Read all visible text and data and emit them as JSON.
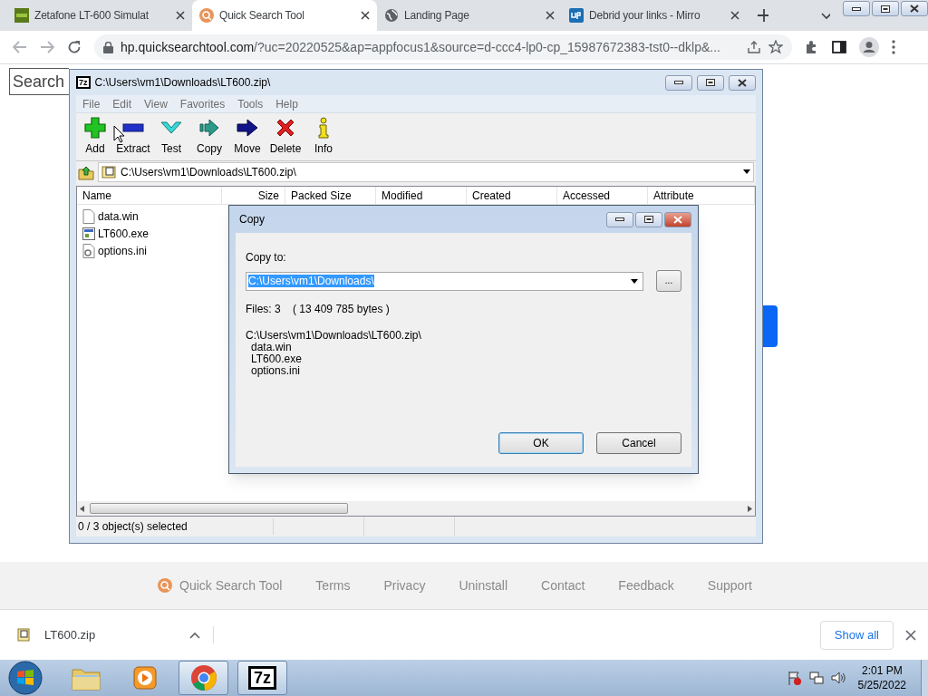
{
  "browser": {
    "tabs": [
      {
        "title": "Zetafone LT-600 Simulat",
        "kind": "phone",
        "selected": false
      },
      {
        "title": "Quick Search Tool",
        "kind": "search",
        "selected": true
      },
      {
        "title": "Landing Page",
        "kind": "globe",
        "selected": false
      },
      {
        "title": "Debrid your links - Mirro",
        "kind": "badge",
        "selected": false
      }
    ],
    "url_host": "hp.quicksearchtool.com",
    "url_rest": "/?uc=20220525&ap=appfocus1&source=d-ccc4-lp0-cp_15987672383-tst0--dklp&..."
  },
  "page": {
    "search_placeholder": "Search",
    "footer": {
      "brand": "Quick Search Tool",
      "links": [
        "Terms",
        "Privacy",
        "Uninstall",
        "Contact",
        "Feedback",
        "Support"
      ]
    }
  },
  "download_bar": {
    "file": "LT600.zip",
    "show_all": "Show all"
  },
  "archive_window": {
    "logo": "7z",
    "title": "C:\\Users\\vm1\\Downloads\\LT600.zip\\",
    "menu": [
      "File",
      "Edit",
      "View",
      "Favorites",
      "Tools",
      "Help"
    ],
    "toolbar": [
      {
        "label": "Add",
        "kind": "add"
      },
      {
        "label": "Extract",
        "kind": "extract"
      },
      {
        "label": "Test",
        "kind": "test"
      },
      {
        "label": "Copy",
        "kind": "copy"
      },
      {
        "label": "Move",
        "kind": "move"
      },
      {
        "label": "Delete",
        "kind": "delete"
      },
      {
        "label": "Info",
        "kind": "info"
      }
    ],
    "path": "C:\\Users\\vm1\\Downloads\\LT600.zip\\",
    "columns": [
      "Name",
      "Size",
      "Packed Size",
      "Modified",
      "Created",
      "Accessed",
      "Attribute"
    ],
    "files": [
      {
        "name": "data.win",
        "kind": "file"
      },
      {
        "name": "LT600.exe",
        "kind": "program"
      },
      {
        "name": "options.ini",
        "kind": "settings"
      }
    ],
    "status": "0 / 3 object(s) selected"
  },
  "copy_dialog": {
    "title": "Copy",
    "label": "Copy to:",
    "destination": "C:\\Users\\vm1\\Downloads\\",
    "text_selected": true,
    "browse": "...",
    "summary": "Files: 3    ( 13 409 785 bytes )",
    "source_lines": [
      "C:\\Users\\vm1\\Downloads\\LT600.zip\\",
      "data.win",
      "LT600.exe",
      "options.ini"
    ],
    "buttons": [
      {
        "label": "OK",
        "default": true
      },
      {
        "label": "Cancel",
        "default": false
      }
    ]
  },
  "taskbar": {
    "apps": [
      {
        "kind": "explorer",
        "active": false
      },
      {
        "kind": "media",
        "active": false
      },
      {
        "kind": "chrome",
        "active": true
      },
      {
        "kind": "sevenzip",
        "label": "7z",
        "active": true
      }
    ],
    "time": "2:01 PM",
    "date": "5/25/2022"
  }
}
